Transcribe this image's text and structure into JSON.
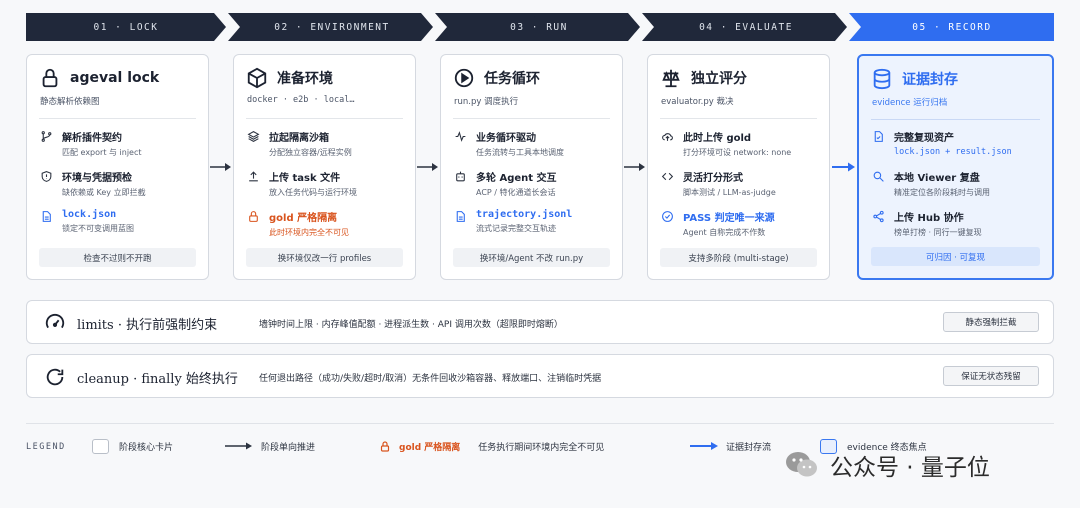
{
  "stages": [
    "01 · LOCK",
    "02 · ENVIRONMENT",
    "03 · RUN",
    "04 · EVALUATE",
    "05 · RECORD"
  ],
  "cards": [
    {
      "title": "ageval lock",
      "subtitle": "静态解析依赖图",
      "icon": "lock-icon",
      "items": [
        {
          "title": "解析插件契约",
          "desc": "匹配 export 与 inject",
          "icon": "git-branch-icon"
        },
        {
          "title": "环境与凭据预检",
          "desc": "缺依赖或 Key 立即拦截",
          "icon": "shield-alert-icon"
        },
        {
          "title": "lock.json",
          "desc": "锁定不可变调用蓝图",
          "icon": "file-icon"
        }
      ],
      "footer": "检查不过则不开跑"
    },
    {
      "title": "准备环境",
      "subtitle": "docker · e2b · local…",
      "icon": "cube-icon",
      "items": [
        {
          "title": "拉起隔离沙箱",
          "desc": "分配独立容器/远程实例",
          "icon": "layers-icon"
        },
        {
          "title": "上传 task 文件",
          "desc": "放入任务代码与运行环境",
          "icon": "upload-icon"
        },
        {
          "title": "gold 严格隔离",
          "desc": "此时环境内完全不可见",
          "icon": "lock-warn-icon"
        }
      ],
      "footer": "换环境仅改一行 profiles"
    },
    {
      "title": "任务循环",
      "subtitle": "run.py 调度执行",
      "icon": "play-icon",
      "items": [
        {
          "title": "业务循环驱动",
          "desc": "任务流转与工具本地调度",
          "icon": "activity-icon"
        },
        {
          "title": "多轮 Agent 交互",
          "desc": "ACP / 特化通道长会话",
          "icon": "agent-icon"
        },
        {
          "title": "trajectory.jsonl",
          "desc": "流式记录完整交互轨迹",
          "icon": "file-icon"
        }
      ],
      "footer": "换环境/Agent 不改 run.py"
    },
    {
      "title": "独立评分",
      "subtitle": "evaluator.py 裁决",
      "icon": "scale-icon",
      "items": [
        {
          "title": "此时上传 gold",
          "desc": "打分环境可设 network: none",
          "icon": "cloud-upload-icon"
        },
        {
          "title": "灵活打分形式",
          "desc": "脚本测试 / LLM-as-judge",
          "icon": "code-icon"
        },
        {
          "title": "PASS 判定唯一来源",
          "desc": "Agent 自称完成不作数",
          "icon": "check-circle-icon"
        }
      ],
      "footer": "支持多阶段 (multi-stage)"
    },
    {
      "title": "证据封存",
      "subtitle": "evidence 运行归档",
      "icon": "database-icon",
      "items": [
        {
          "title": "完整复现资产",
          "desc": "lock.json + result.json",
          "icon": "file-check-icon"
        },
        {
          "title": "本地 Viewer 复盘",
          "desc": "精准定位各阶段耗时与调用",
          "icon": "search-icon"
        },
        {
          "title": "上传 Hub 协作",
          "desc": "榜单打榜 · 同行一键复现",
          "icon": "share-icon"
        }
      ],
      "footer": "可归因 · 可复现"
    }
  ],
  "bars": [
    {
      "title": "limits · 执行前强制约束",
      "desc": "墙钟时间上限 · 内存峰值配额 · 进程派生数 · API 调用次数（超限即时熔断）",
      "button": "静态强制拦截",
      "icon": "gauge-icon"
    },
    {
      "title": "cleanup · finally 始终执行",
      "desc": "任何退出路径（成功/失败/超时/取消）无条件回收沙箱容器、释放端口、注销临时凭据",
      "button": "保证无状态残留",
      "icon": "refresh-icon"
    }
  ],
  "legend": {
    "label": "LEGEND",
    "card": "阶段核心卡片",
    "arrow": "阶段单向推进",
    "gold": "gold 严格隔离",
    "gold_desc": "任务执行期间环境内完全不可见",
    "evidence_flow": "证据封存流",
    "evidence_focus": "evidence 终态焦点"
  },
  "watermark": "公众号 · 量子位",
  "colors": {
    "dark": "#20283a",
    "accent": "#2f6df0",
    "warn": "#d9541e"
  }
}
